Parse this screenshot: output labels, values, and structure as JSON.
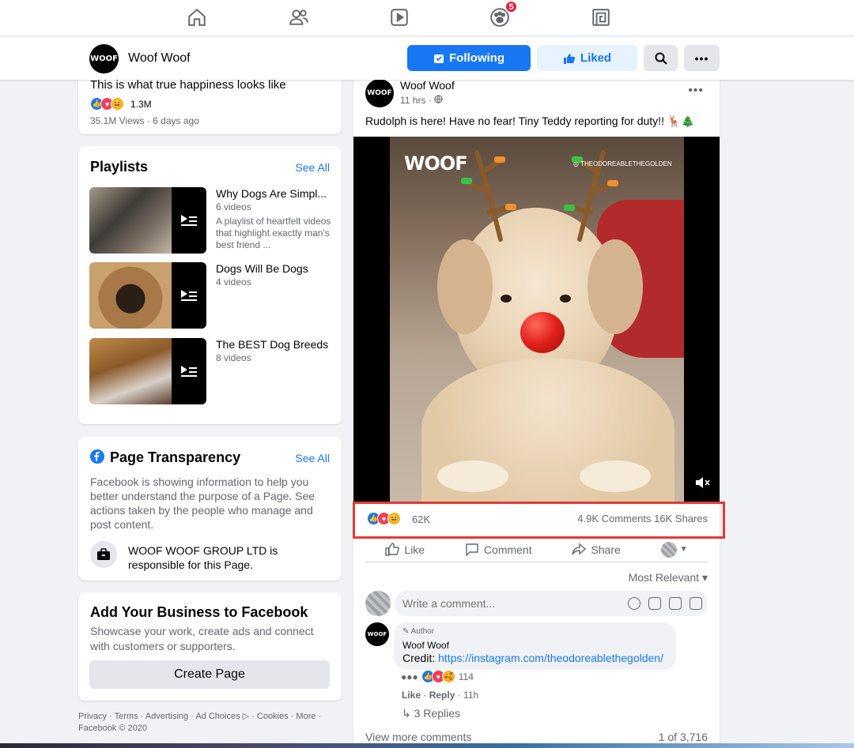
{
  "nav": {
    "notification_count": "5"
  },
  "page": {
    "logo": "WOOF",
    "name": "Woof Woof",
    "following_label": "Following",
    "liked_label": "Liked",
    "more_label": "•••"
  },
  "top_video": {
    "title": "This is what true happiness looks like",
    "reaction_count": "1.3M",
    "meta": "35.1M Views · 6 days ago"
  },
  "playlists": {
    "title": "Playlists",
    "see_all": "See All",
    "items": [
      {
        "name": "Why Dogs Are Simpl...",
        "count": "6 videos",
        "desc": "A playlist of heartfelt videos that highlight exactly man's best friend ..."
      },
      {
        "name": "Dogs Will Be Dogs",
        "count": "4 videos",
        "desc": ""
      },
      {
        "name": "The BEST Dog Breeds",
        "count": "8 videos",
        "desc": ""
      }
    ]
  },
  "transparency": {
    "title": "Page Transparency",
    "see_all": "See All",
    "text": "Facebook is showing information to help you better understand the purpose of a Page. See actions taken by the people who manage and post content.",
    "responsible": "WOOF WOOF GROUP LTD is responsible for this Page."
  },
  "business": {
    "title": "Add Your Business to Facebook",
    "text": "Showcase your work, create ads and connect with customers or supporters.",
    "button": "Create Page"
  },
  "footer": {
    "text": "Privacy · Terms · Advertising · Ad Choices ▷ · Cookies · More · Facebook © 2020"
  },
  "post": {
    "author": "Woof Woof",
    "time": "11 hrs · ",
    "more": "•••",
    "caption": "Rudolph is here! Have no fear! Tiny Teddy reporting for duty!! 🦌🎄",
    "video_logo": "WOOF",
    "video_handle": "◎ THEODOREABLETHEGOLDEN",
    "reaction_count": "62K",
    "comments_shares": "4.9K Comments  16K Shares",
    "actions": {
      "like": "Like",
      "comment": "Comment",
      "share": "Share"
    },
    "sort": "Most Relevant ▾",
    "comment_placeholder": "Write a comment...",
    "comment": {
      "badge": "✎ Author",
      "name": "Woof Woof",
      "credit_prefix": "Credit: ",
      "credit_link": "https://instagram.com/theodoreablethegolden/",
      "react_count": "114",
      "like": "Like",
      "reply": "Reply",
      "time": "11h",
      "replies": "↳ 3 Replies"
    },
    "view_more": "View more comments",
    "page_count": "1 of 3,716"
  }
}
